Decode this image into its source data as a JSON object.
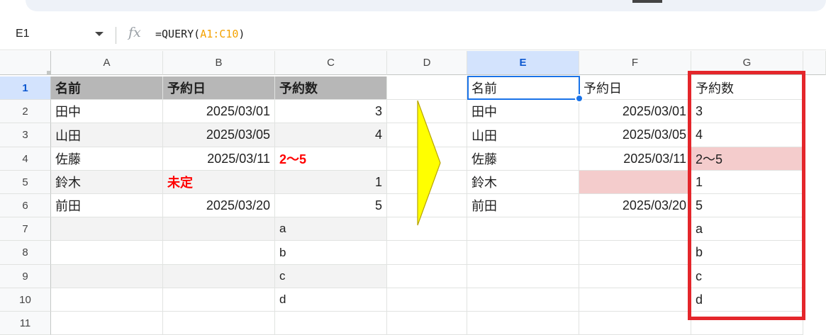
{
  "formula_bar": {
    "name_box": "E1",
    "fx_icon": "fx",
    "formula_prefix": "=QUERY(",
    "formula_range": "A1:C10",
    "formula_suffix": ")"
  },
  "columns": [
    "A",
    "B",
    "C",
    "D",
    "E",
    "F",
    "G"
  ],
  "rows": [
    "1",
    "2",
    "3",
    "4",
    "5",
    "6",
    "7",
    "8",
    "9",
    "10",
    "11"
  ],
  "source_table": {
    "header": [
      "名前",
      "予約日",
      "予約数"
    ],
    "rows": [
      [
        "田中",
        "2025/03/01",
        "3"
      ],
      [
        "山田",
        "2025/03/05",
        "4"
      ],
      [
        "佐藤",
        "2025/03/11",
        "2〜5"
      ],
      [
        "鈴木",
        "未定",
        "1"
      ],
      [
        "前田",
        "2025/03/20",
        "5"
      ],
      [
        "",
        "",
        "a"
      ],
      [
        "",
        "",
        "b"
      ],
      [
        "",
        "",
        "c"
      ],
      [
        "",
        "",
        "d"
      ]
    ]
  },
  "result_table": {
    "header": [
      "名前",
      "予約日",
      "予約数"
    ],
    "rows": [
      [
        "田中",
        "2025/03/01",
        "3"
      ],
      [
        "山田",
        "2025/03/05",
        "4"
      ],
      [
        "佐藤",
        "2025/03/11",
        "2〜5"
      ],
      [
        "鈴木",
        "",
        "1"
      ],
      [
        "前田",
        "2025/03/20",
        "5"
      ],
      [
        "",
        "",
        "a"
      ],
      [
        "",
        "",
        "b"
      ],
      [
        "",
        "",
        "c"
      ],
      [
        "",
        "",
        "d"
      ]
    ]
  },
  "colors": {
    "header_fill": "#b7b7b7",
    "alt_row_fill": "#f3f3f3",
    "error_fill": "#f4cccc",
    "highlight_text": "#ff0000",
    "selection": "#1a73e8",
    "highlight_box": "#e4262b",
    "arrow_fill": "#ffff00"
  }
}
